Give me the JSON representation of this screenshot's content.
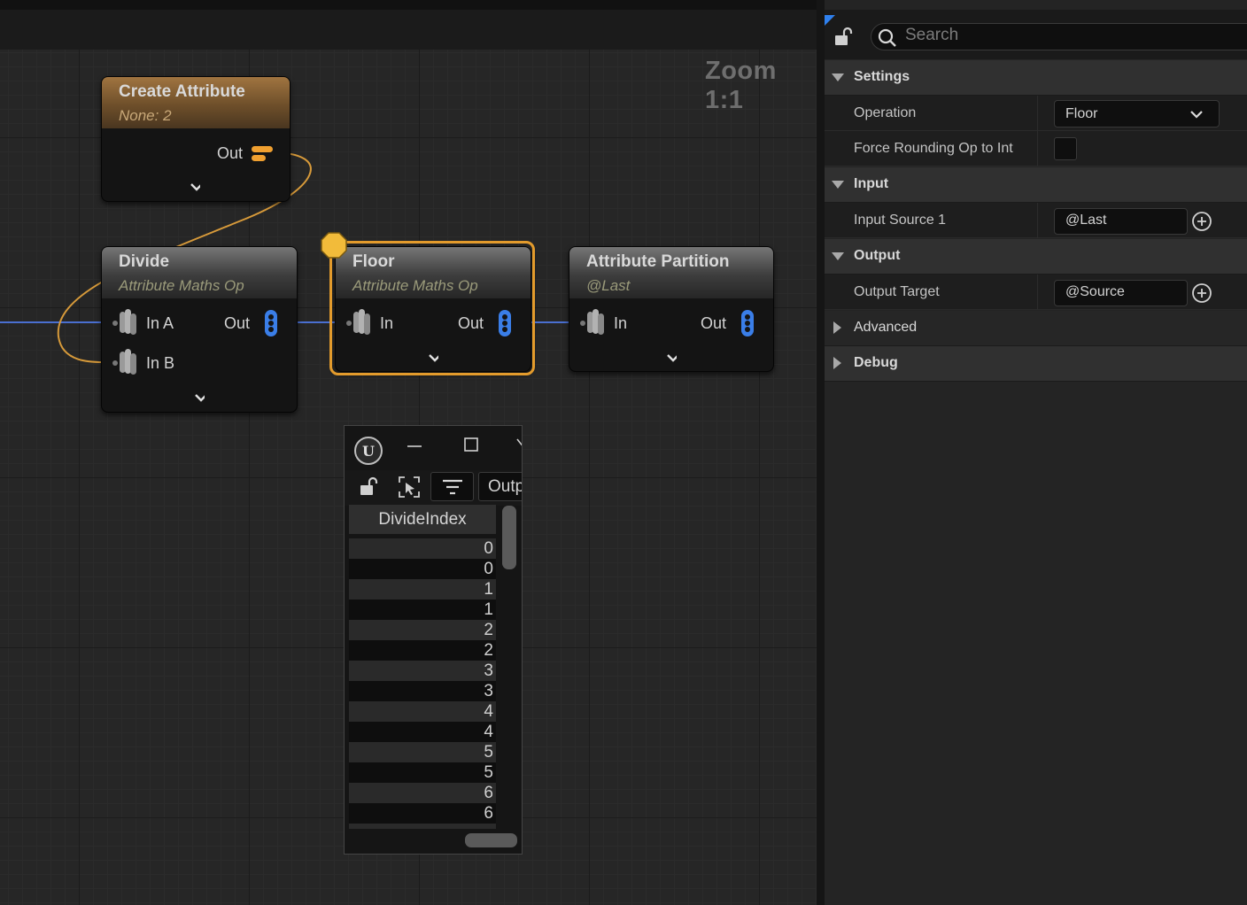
{
  "graph": {
    "zoom_label": "Zoom 1:1",
    "nodes": {
      "create_attribute": {
        "title": "Create Attribute",
        "subtitle": "None: 2",
        "out_label": "Out"
      },
      "divide": {
        "title": "Divide",
        "subtitle": "Attribute Maths Op",
        "in_a_label": "In A",
        "in_b_label": "In B",
        "out_label": "Out"
      },
      "floor": {
        "title": "Floor",
        "subtitle": "Attribute Maths Op",
        "in_label": "In",
        "out_label": "Out"
      },
      "attribute_partition": {
        "title": "Attribute Partition",
        "subtitle": "@Last",
        "in_label": "In",
        "out_label": "Out"
      }
    }
  },
  "data_window": {
    "output_tab_label": "Outp",
    "column_header": "DivideIndex",
    "values": [
      "0",
      "0",
      "1",
      "1",
      "2",
      "2",
      "3",
      "3",
      "4",
      "4",
      "5",
      "5",
      "6",
      "6"
    ]
  },
  "details": {
    "search_placeholder": "Search",
    "categories": {
      "settings": "Settings",
      "input": "Input",
      "output": "Output",
      "advanced": "Advanced",
      "debug": "Debug"
    },
    "properties": {
      "operation_label": "Operation",
      "operation_value": "Floor",
      "force_rounding_label": "Force Rounding Op to Int",
      "force_rounding_checked": false,
      "input_source_label": "Input Source 1",
      "input_source_value": "@Last",
      "output_target_label": "Output Target",
      "output_target_value": "@Source"
    }
  },
  "colors": {
    "selection": "#e39b2c",
    "wire_blue": "#4a6fd0",
    "wire_orange": "#d79a3a",
    "pin_blue": "#3a7ee8",
    "pin_orange": "#f0a030"
  },
  "icons": [
    "lock-icon",
    "search-icon",
    "unreal-logo-icon",
    "minimize-icon",
    "maximize-icon",
    "filter-icon",
    "select-icon",
    "chevron-down-icon",
    "add-icon",
    "attribute-set-icon"
  ]
}
